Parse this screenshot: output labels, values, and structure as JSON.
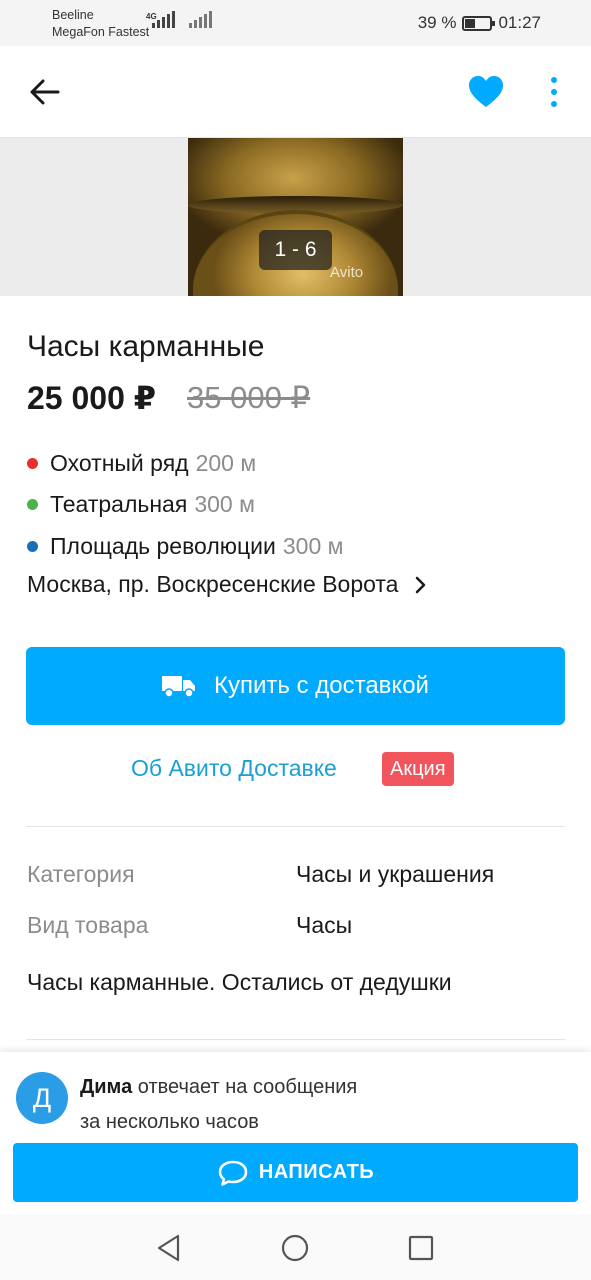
{
  "status_bar": {
    "carrier_1": "Beeline",
    "carrier_2": "MegaFon Fastest",
    "network": "4G",
    "battery_percent": "39 %",
    "battery_level": 0.39,
    "time": "01:27"
  },
  "app_bar": {
    "back_icon": "arrow-left-icon",
    "favorite_icon": "heart-icon",
    "favorite_color": "#00aaff",
    "more_icon": "vertical-dots-icon"
  },
  "gallery": {
    "counter": "1 - 6",
    "watermark": "Avito"
  },
  "listing": {
    "title": "Часы карманные",
    "price": "25 000 ₽",
    "old_price": "35 000 ₽"
  },
  "metro": [
    {
      "station": "Охотный ряд",
      "distance": "200 м",
      "color": "#e4312c"
    },
    {
      "station": "Театральная",
      "distance": "300 м",
      "color": "#4ab34a"
    },
    {
      "station": "Площадь революции",
      "distance": "300 м",
      "color": "#1a6fb7"
    }
  ],
  "address": "Москва, пр. Воскресенские Ворота",
  "delivery": {
    "buy_label": "Купить с доставкой",
    "info_link": "Об Авито Доставке",
    "promo_badge": "Акция"
  },
  "params": [
    {
      "label": "Категория",
      "value": "Часы и украшения"
    },
    {
      "label": "Вид товара",
      "value": "Часы"
    }
  ],
  "description": "Часы карманные. Остались от дедушки",
  "seller": {
    "avatar_letter": "Д",
    "name": "Дима",
    "reply_text_1": "отвечает на сообщения",
    "reply_text_2": "за несколько часов",
    "write_label": "НАПИСАТЬ"
  },
  "nav": {
    "back_icon": "triangle-back-icon",
    "home_icon": "circle-home-icon",
    "recents_icon": "square-recents-icon"
  },
  "colors": {
    "accent": "#00aaff",
    "promo": "#f2545b",
    "link": "#1a9fd6"
  }
}
